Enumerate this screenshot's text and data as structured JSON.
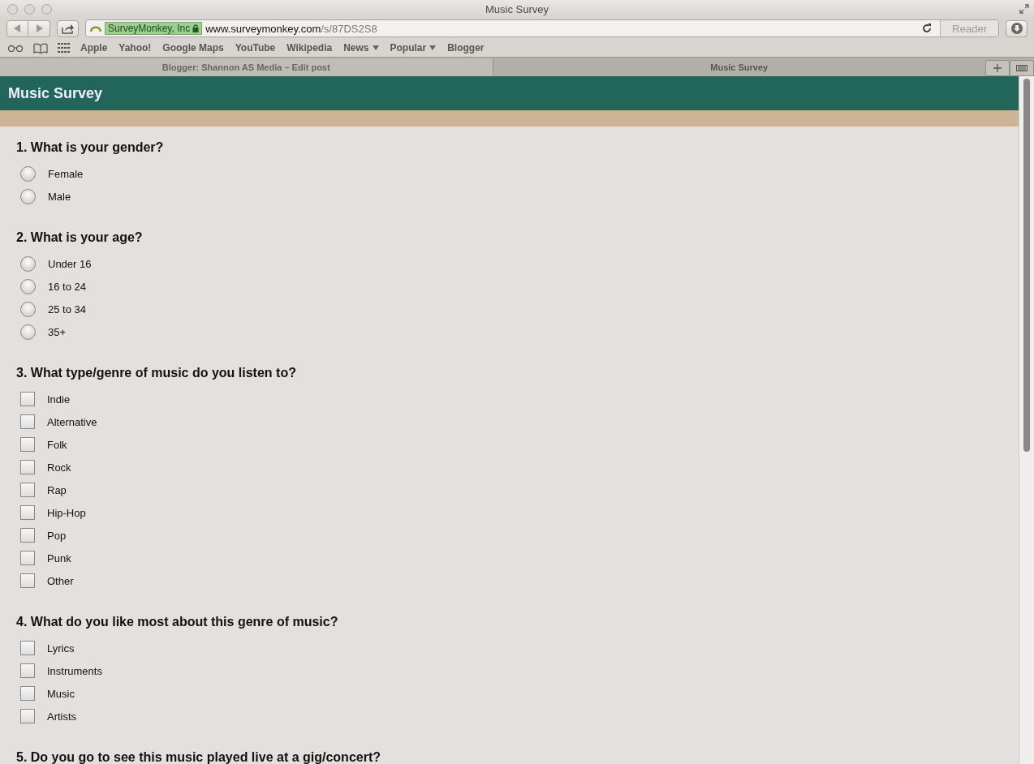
{
  "window": {
    "title": "Music Survey"
  },
  "toolbar": {
    "site_identity": "SurveyMonkey, Inc",
    "url_host": "www.surveymonkey.com",
    "url_path": "/s/87DS2S8",
    "reader": "Reader"
  },
  "bookmarks": [
    {
      "label": "Apple",
      "menu": false
    },
    {
      "label": "Yahoo!",
      "menu": false
    },
    {
      "label": "Google Maps",
      "menu": false
    },
    {
      "label": "YouTube",
      "menu": false
    },
    {
      "label": "Wikipedia",
      "menu": false
    },
    {
      "label": "News",
      "menu": true
    },
    {
      "label": "Popular",
      "menu": true
    },
    {
      "label": "Blogger",
      "menu": false
    }
  ],
  "tabs": [
    {
      "label": "Blogger: Shannon AS Media – Edit post",
      "selected": false
    },
    {
      "label": "Music Survey",
      "selected": true
    }
  ],
  "page": {
    "header": "Music Survey"
  },
  "questions": [
    {
      "title": "1. What is your gender?",
      "kind": "radio",
      "options": [
        {
          "label": "Female",
          "checked": false
        },
        {
          "label": "Male",
          "checked": false
        }
      ]
    },
    {
      "title": "2. What is your age?",
      "kind": "radio",
      "options": [
        {
          "label": "Under 16",
          "checked": false
        },
        {
          "label": "16 to 24",
          "checked": false
        },
        {
          "label": "25 to 34",
          "checked": false
        },
        {
          "label": "35+",
          "checked": false
        }
      ]
    },
    {
      "title": "3. What type/genre of music do you listen to?",
      "kind": "checkbox",
      "options": [
        {
          "label": "Indie",
          "checked": false
        },
        {
          "label": "Alternative",
          "checked": false
        },
        {
          "label": "Folk",
          "checked": false
        },
        {
          "label": "Rock",
          "checked": false
        },
        {
          "label": "Rap",
          "checked": false
        },
        {
          "label": "Hip-Hop",
          "checked": false
        },
        {
          "label": "Pop",
          "checked": false
        },
        {
          "label": "Punk",
          "checked": false
        },
        {
          "label": "Other",
          "checked": false
        }
      ]
    },
    {
      "title": "4. What do you like most about this genre of music?",
      "kind": "checkbox",
      "options": [
        {
          "label": "Lyrics",
          "checked": false
        },
        {
          "label": "Instruments",
          "checked": false
        },
        {
          "label": "Music",
          "checked": false
        },
        {
          "label": "Artists",
          "checked": false
        }
      ]
    },
    {
      "title": "5. Do you go to see this music played live at a gig/concert?"
    }
  ]
}
